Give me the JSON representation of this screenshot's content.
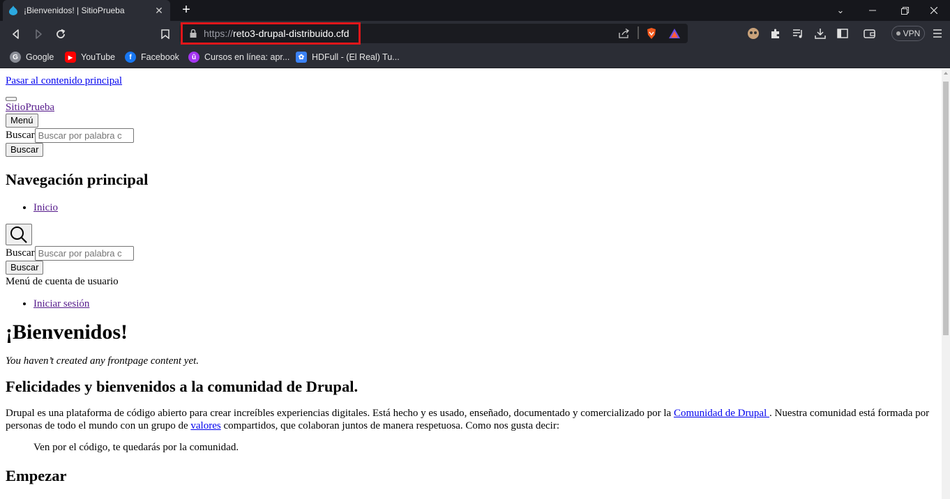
{
  "browser": {
    "tab_title": "¡Bienvenidos! | SitioPrueba",
    "url_scheme": "https://",
    "url_host": "reto3-drupal-distribuido.cfd",
    "vpn_label": "VPN",
    "bookmarks": [
      {
        "label": "Google",
        "icon": "google-icon",
        "color": "#8a8d96"
      },
      {
        "label": "YouTube",
        "icon": "youtube-icon",
        "color": "#ff0000"
      },
      {
        "label": "Facebook",
        "icon": "facebook-icon",
        "color": "#1877f2"
      },
      {
        "label": "Cursos en línea: apr...",
        "icon": "udemy-icon",
        "color": "#a435f0"
      },
      {
        "label": "HDFull - (El Real) Tu...",
        "icon": "hdfull-icon",
        "color": "#3b82f6"
      }
    ]
  },
  "page": {
    "skip_link": "Pasar al contenido principal",
    "site_name": "SitioPrueba",
    "menu_button": "Menú",
    "search_label": "Buscar",
    "search_placeholder": "Buscar por palabra c",
    "search_button": "Buscar",
    "main_nav_heading": "Navegación principal",
    "nav_items": [
      "Inicio"
    ],
    "search_label_2": "Buscar",
    "search_placeholder_2": "Buscar por palabra c",
    "search_button_2": "Buscar",
    "account_menu_label": "Menú de cuenta de usuario",
    "account_items": [
      "Iniciar sesión"
    ],
    "title": "¡Bienvenidos!",
    "empty_notice": "You haven’t created any frontpage content yet.",
    "welcome_heading": "Felicidades y bienvenidos a la comunidad de Drupal.",
    "para1_a": "Drupal es una plataforma de código abierto para crear increíbles experiencias digitales. Está hecho y es usado, enseñado, documentado y comercializado por la ",
    "para1_link1": "Comunidad de Drupal ",
    "para1_b": ". Nuestra comunidad está formada por personas de todo el mundo con un grupo de ",
    "para1_link2": "valores",
    "para1_c": " compartidos, que colaboran juntos de manera respetuosa. Como nos gusta decir:",
    "quote": "Ven por el código, te quedarás por la comunidad.",
    "next_heading": "Empezar"
  }
}
